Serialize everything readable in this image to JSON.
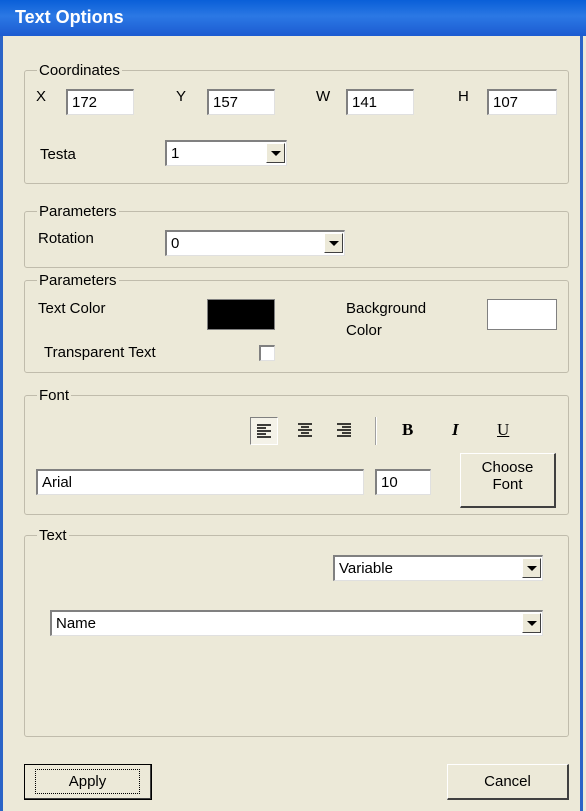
{
  "window": {
    "title": "Text Options"
  },
  "coordinates": {
    "legend": "Coordinates",
    "x_label": "X",
    "x_value": "172",
    "y_label": "Y",
    "y_value": "157",
    "w_label": "W",
    "w_value": "141",
    "h_label": "H",
    "h_value": "107",
    "testa_label": "Testa",
    "testa_value": "1"
  },
  "parameters1": {
    "legend": "Parameters",
    "rotation_label": "Rotation",
    "rotation_value": "0"
  },
  "parameters2": {
    "legend": "Parameters",
    "text_color_label": "Text Color",
    "background_label_1": "Background",
    "background_label_2": "Color",
    "transparent_label": "Transparent Text",
    "text_color": "#000000",
    "background_color": "#ffffff"
  },
  "font": {
    "legend": "Font",
    "bold_label": "B",
    "italic_label": "I",
    "underline_label": "U",
    "name_value": "Arial",
    "size_value": "10",
    "choose_font_1": "Choose",
    "choose_font_2": "Font"
  },
  "text": {
    "legend": "Text",
    "type_value": "Variable",
    "field_value": "Name"
  },
  "buttons": {
    "apply_label": "Apply",
    "cancel_label": "Cancel"
  }
}
